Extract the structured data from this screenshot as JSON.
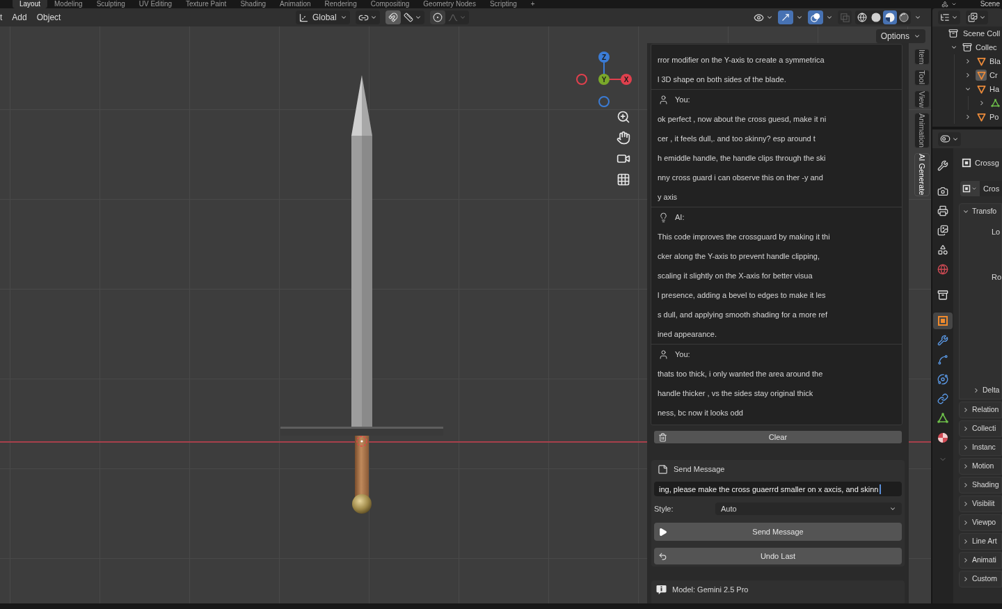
{
  "workspace_tabs": [
    {
      "label": "Layout",
      "selected": true
    },
    {
      "label": "Modeling",
      "selected": false
    },
    {
      "label": "Sculpting",
      "selected": false
    },
    {
      "label": "UV Editing",
      "selected": false
    },
    {
      "label": "Texture Paint",
      "selected": false
    },
    {
      "label": "Shading",
      "selected": false
    },
    {
      "label": "Animation",
      "selected": false
    },
    {
      "label": "Rendering",
      "selected": false
    },
    {
      "label": "Compositing",
      "selected": false
    },
    {
      "label": "Geometry Nodes",
      "selected": false
    },
    {
      "label": "Scripting",
      "selected": false
    },
    {
      "label": "+",
      "selected": false
    }
  ],
  "scene_selector": {
    "label": "Scene"
  },
  "viewport_header": {
    "menus": [
      "t",
      "Add",
      "Object"
    ],
    "orientation": "Global",
    "snap": {
      "on": true
    },
    "proportional": {
      "on": false
    },
    "gizmos": {
      "on": true
    },
    "overlays": {
      "on": true
    },
    "xray": {
      "on": false
    },
    "shading_modes": [
      {
        "kind": "wireframe",
        "selected": false
      },
      {
        "kind": "solid",
        "selected": false
      },
      {
        "kind": "material",
        "selected": true
      },
      {
        "kind": "rendered",
        "selected": false
      }
    ]
  },
  "viewport": {
    "options_button": "Options",
    "navigation_gizmo": {
      "axes": [
        {
          "kind": "positive",
          "label": "Z",
          "color": "#3b7cd6"
        },
        {
          "kind": "positive",
          "label": "Y",
          "color": "#7aa82a"
        },
        {
          "kind": "positive",
          "label": "X",
          "color": "#e0404d"
        },
        {
          "kind": "negative",
          "color": "#e0404d"
        },
        {
          "kind": "negative",
          "color": "#3b7cd6"
        }
      ]
    }
  },
  "sidebar": {
    "tabs": [
      {
        "label": "Item",
        "selected": false
      },
      {
        "label": "Tool",
        "selected": false
      },
      {
        "label": "View",
        "selected": false
      },
      {
        "label": "Animation",
        "selected": false
      },
      {
        "label": "AI Generate",
        "selected": true
      }
    ],
    "chat": [
      {
        "kind": "continued",
        "lines": [
          "rror modifier on the Y-axis to create a symmetrica",
          "l 3D shape on both sides of the blade."
        ]
      },
      {
        "kind": "user",
        "author": "You:",
        "lines": [
          "ok perfect , now about the cross guesd, make it ni",
          "cer , it feels dull,. and too skinny? esp around t",
          "h emiddle handle, the handle clips through the ski",
          "nny cross guard i can observe this on ther -y and",
          "y axis"
        ]
      },
      {
        "kind": "ai",
        "author": "AI:",
        "lines": [
          "This code improves the crossguard by making it thi",
          "cker along the Y-axis to prevent handle clipping,",
          "scaling it slightly on the X-axis for better visua",
          "l presence, adding a bevel to edges to make it les",
          "s dull, and applying smooth shading for a more ref",
          "ined appearance."
        ]
      },
      {
        "kind": "user",
        "author": "You:",
        "lines": [
          "thats too thick, i only wanted the area around the",
          "handle thicker , vs the sides stay original thick",
          "ness, bc now it looks odd"
        ]
      }
    ],
    "clear_button": "Clear",
    "send_panel": {
      "title": "Send Message",
      "input": {
        "value": "ing, please make the cross guaerrd smaller on x axcis, and skinn",
        "focused": true
      },
      "style": {
        "label": "Style:",
        "value": "Auto"
      },
      "send_button": "Send Message",
      "undo_button": "Undo Last"
    },
    "model_panel": {
      "title": "Model: Gemini 2.5 Pro"
    }
  },
  "outliner": {
    "items": [
      {
        "kind": "scene_collection",
        "label": "Scene Coll",
        "selected": false,
        "children": [
          {
            "kind": "collection",
            "label": "Collec",
            "selected": false,
            "expanded": true,
            "children": [
              {
                "kind": "mesh_object",
                "label": "Bla",
                "selected": false,
                "expanded": false
              },
              {
                "kind": "mesh_object",
                "label": "Cr",
                "selected": true,
                "expanded": false
              },
              {
                "kind": "mesh_object",
                "label": "Ha",
                "selected": false,
                "expanded": true,
                "children": [
                  {
                    "kind": "mesh_data",
                    "selected": false,
                    "expanded": false
                  }
                ]
              },
              {
                "kind": "mesh_object",
                "label": "Po",
                "selected": false,
                "expanded": false
              }
            ]
          }
        ]
      }
    ]
  },
  "properties": {
    "tabs": [
      {
        "kind": "tool",
        "selected": false
      },
      {
        "kind": "render",
        "selected": false
      },
      {
        "kind": "output",
        "selected": false
      },
      {
        "kind": "view_layer",
        "selected": false
      },
      {
        "kind": "scene",
        "selected": false
      },
      {
        "kind": "world",
        "selected": false
      },
      {
        "kind": "collection",
        "selected": false
      },
      {
        "kind": "object",
        "selected": true
      },
      {
        "kind": "modifiers",
        "selected": false
      },
      {
        "kind": "particles",
        "selected": false
      },
      {
        "kind": "physics",
        "selected": false
      },
      {
        "kind": "constraints",
        "selected": false
      },
      {
        "kind": "data",
        "selected": false
      },
      {
        "kind": "material",
        "selected": false
      }
    ],
    "object_name": "Crossg",
    "data_name": "Cros",
    "panels": [
      {
        "title": "Transfo",
        "expanded": true,
        "fields": [
          "Lo",
          "Ro"
        ],
        "subpanels": [
          {
            "title": "Delta",
            "expanded": false
          }
        ]
      },
      {
        "title": "Relation",
        "expanded": false
      },
      {
        "title": "Collecti",
        "expanded": false
      },
      {
        "title": "Instanc",
        "expanded": false
      },
      {
        "title": "Motion",
        "expanded": false
      },
      {
        "title": "Shading",
        "expanded": false
      },
      {
        "title": "Visibilit",
        "expanded": false
      },
      {
        "title": "Viewpo",
        "expanded": false
      },
      {
        "title": "Line Art",
        "expanded": false
      },
      {
        "title": "Animati",
        "expanded": false
      },
      {
        "title": "Custom",
        "expanded": false
      }
    ]
  }
}
